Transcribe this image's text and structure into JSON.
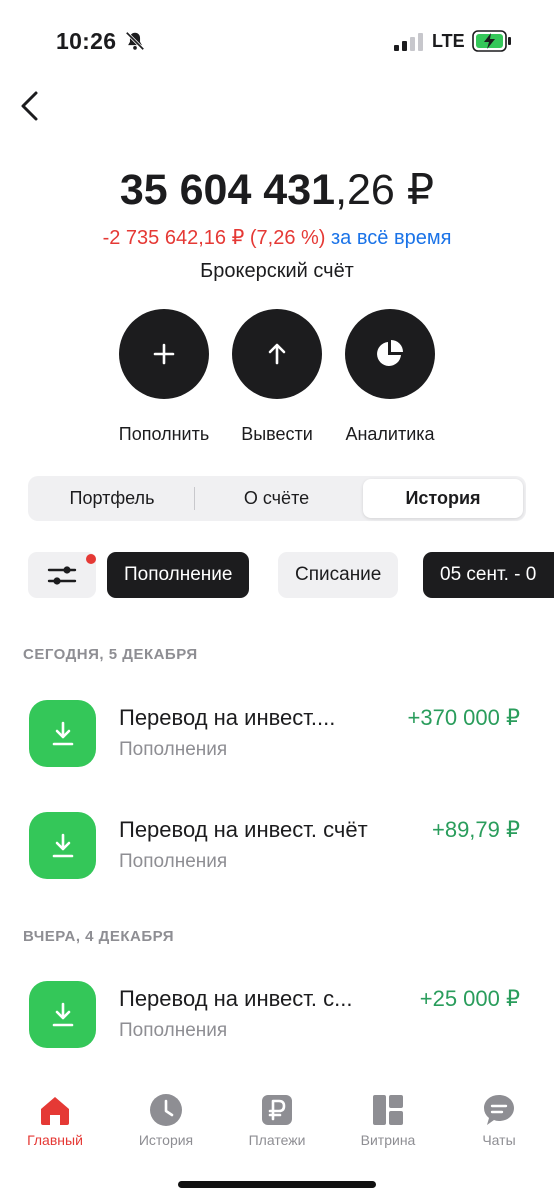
{
  "status_bar": {
    "time": "10:26",
    "network": "LTE"
  },
  "balance": {
    "integer": "35 604 431",
    "fraction": ",26 ₽"
  },
  "change": {
    "value": "-2 735 642,16 ₽ (7,26 %)",
    "period": "за всё время"
  },
  "account_name": "Брокерский счёт",
  "actions": [
    {
      "label": "Пополнить",
      "icon": "plus-icon"
    },
    {
      "label": "Вывести",
      "icon": "arrow-up-icon"
    },
    {
      "label": "Аналитика",
      "icon": "pie-chart-icon"
    }
  ],
  "segments": [
    {
      "label": "Портфель"
    },
    {
      "label": "О счёте"
    },
    {
      "label": "История",
      "selected": true
    }
  ],
  "filters": {
    "deposit": "Пополнение",
    "withdrawal": "Списание",
    "date": "05 сент. - 0"
  },
  "history": [
    {
      "header": "СЕГОДНЯ, 5 ДЕКАБРЯ",
      "items": [
        {
          "title": "Перевод на инвест....",
          "category": "Пополнения",
          "amount": "+370 000 ₽"
        },
        {
          "title": "Перевод на инвест. счёт",
          "category": "Пополнения",
          "amount": "+89,79 ₽"
        }
      ]
    },
    {
      "header": "ВЧЕРА, 4 ДЕКАБРЯ",
      "items": [
        {
          "title": "Перевод на инвест. с...",
          "category": "Пополнения",
          "amount": "+25 000 ₽"
        }
      ]
    }
  ],
  "tabbar": [
    {
      "label": "Главный",
      "icon": "home-icon",
      "active": true
    },
    {
      "label": "История",
      "icon": "clock-icon"
    },
    {
      "label": "Платежи",
      "icon": "ruble-icon"
    },
    {
      "label": "Витрина",
      "icon": "showcase-icon"
    },
    {
      "label": "Чаты",
      "icon": "chat-icon"
    }
  ],
  "colors": {
    "accent_red": "#e53935",
    "link_blue": "#1a73e8",
    "positive_green": "#2a9d5c",
    "icon_green": "#34c759",
    "dark": "#1c1c1e"
  }
}
